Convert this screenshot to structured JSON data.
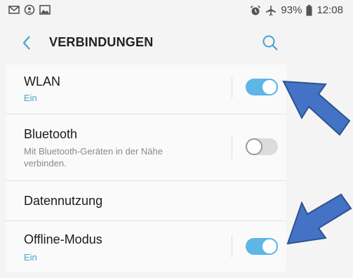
{
  "status_bar": {
    "left_icons": [
      "mail-icon",
      "account-circle-icon",
      "image-icon"
    ],
    "right_icons": [
      "alarm-icon",
      "airplane-mode-icon",
      "battery-icon"
    ],
    "battery": "93%",
    "time": "12:08"
  },
  "header": {
    "title": "VERBINDUNGEN",
    "back_icon": "back-arrow-icon",
    "search_icon": "search-icon"
  },
  "settings": {
    "wlan": {
      "title": "WLAN",
      "subtitle": "Ein",
      "toggle_on": true
    },
    "bluetooth": {
      "title": "Bluetooth",
      "subtitle_line1": "Mit Bluetooth-Geräten in der Nähe",
      "subtitle_line2": "verbinden.",
      "toggle_on": false
    },
    "data_usage": {
      "title": "Datennutzung"
    },
    "offline_mode": {
      "title": "Offline-Modus",
      "subtitle": "Ein",
      "toggle_on": true
    }
  },
  "colors": {
    "accent": "#5db6e6",
    "subtitle_blue": "#4a9fd3",
    "annotation_arrow_fill": "#4472c4",
    "annotation_arrow_stroke": "#2f528f"
  }
}
